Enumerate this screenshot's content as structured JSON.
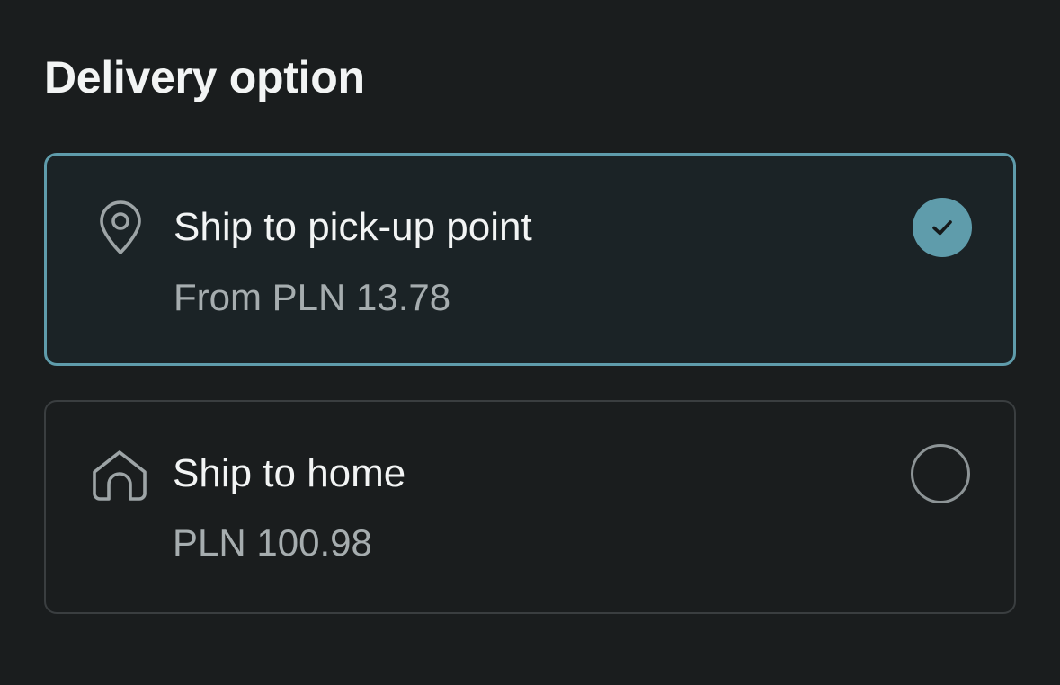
{
  "header": {
    "title": "Delivery option"
  },
  "options": [
    {
      "title": "Ship to pick-up point",
      "price": "From PLN 13.78",
      "icon": "location-pin-icon",
      "selected": true
    },
    {
      "title": "Ship to home",
      "price": "PLN 100.98",
      "icon": "home-icon",
      "selected": false
    }
  ],
  "colors": {
    "background": "#1a1d1e",
    "accent": "#5f9cab",
    "selected_card_bg": "#1b2326",
    "border": "#3a3e40",
    "text_primary": "#f2f4f4",
    "text_secondary": "#a6adaf"
  }
}
